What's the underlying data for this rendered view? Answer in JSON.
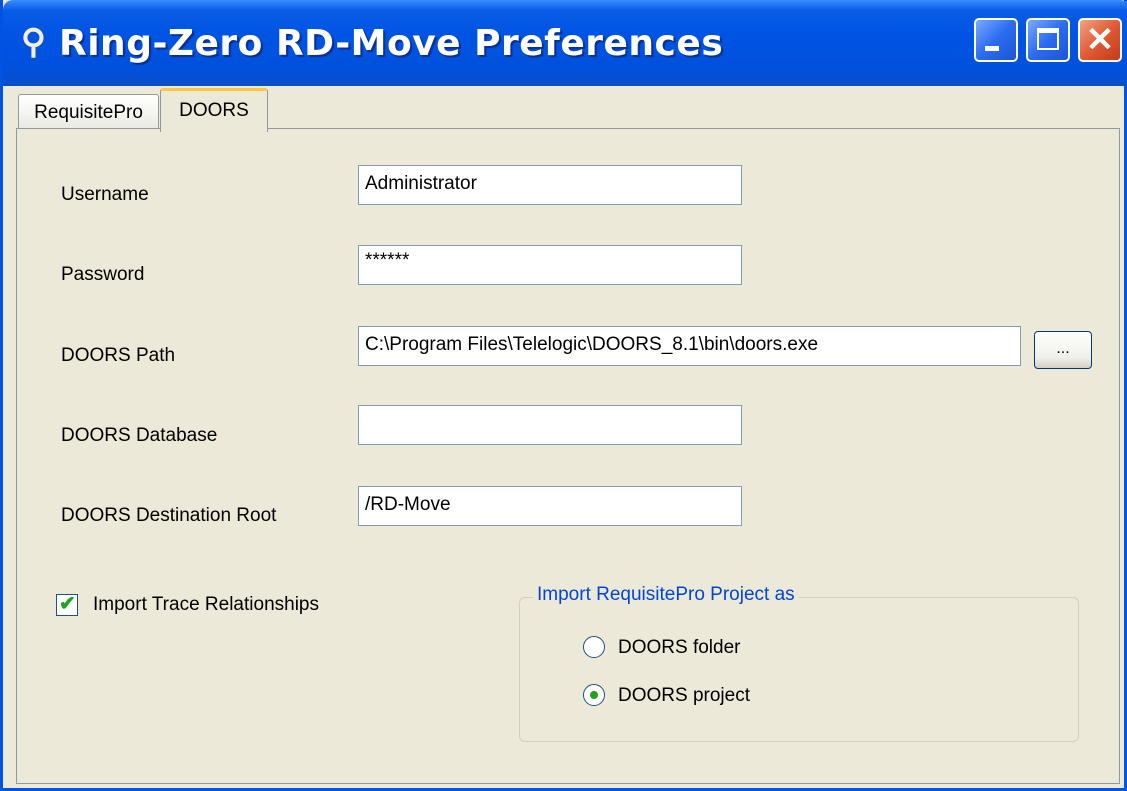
{
  "window": {
    "title": "Ring-Zero RD-Move Preferences",
    "title_icon": "wrench-icon",
    "controls": {
      "minimize": "minimize-icon",
      "maximize": "maximize-icon",
      "close": "✕"
    }
  },
  "tabs": [
    {
      "label": "RequisitePro",
      "selected": false
    },
    {
      "label": "DOORS",
      "selected": true
    }
  ],
  "form": {
    "username": {
      "label": "Username",
      "value": "Administrator"
    },
    "password": {
      "label": "Password",
      "value": "******"
    },
    "doors_path": {
      "label": "DOORS Path",
      "value": "C:\\Program Files\\Telelogic\\DOORS_8.1\\bin\\doors.exe",
      "browse_label": "..."
    },
    "doors_database": {
      "label": "DOORS Database",
      "value": ""
    },
    "doors_destination_root": {
      "label": "DOORS Destination Root",
      "value": "/RD-Move"
    }
  },
  "import_trace": {
    "label": "Import Trace Relationships",
    "checked": true
  },
  "import_as": {
    "title": "Import RequisitePro Project as",
    "options": [
      {
        "label": "DOORS folder",
        "selected": false
      },
      {
        "label": "DOORS project",
        "selected": true
      }
    ]
  },
  "colors": {
    "titlebar": "#0054E3",
    "group_title": "#0046D5",
    "check": "#21A121",
    "tab_highlight": "#FFC83C"
  }
}
